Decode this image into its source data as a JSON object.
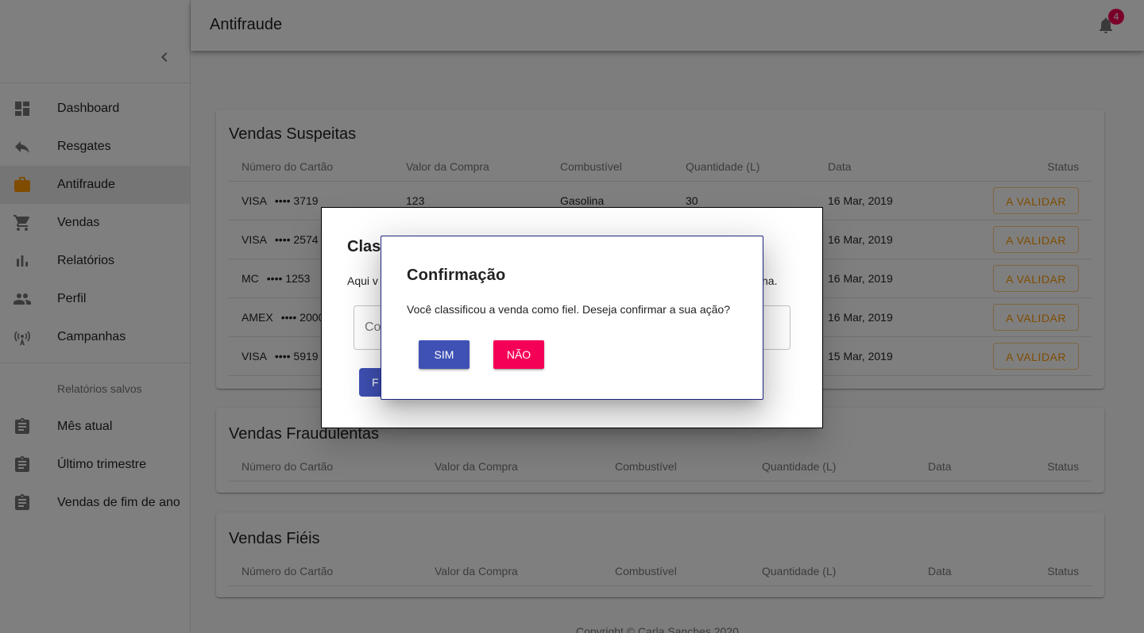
{
  "appbar": {
    "title": "Antifraude",
    "notification_count": "4"
  },
  "sidebar": {
    "items": [
      {
        "label": "Dashboard",
        "icon": "dashboard-icon"
      },
      {
        "label": "Resgates",
        "icon": "reply-icon"
      },
      {
        "label": "Antifraude",
        "icon": "briefcase-icon",
        "active": true
      },
      {
        "label": "Vendas",
        "icon": "cart-icon"
      },
      {
        "label": "Relatórios",
        "icon": "bar-chart-icon"
      },
      {
        "label": "Perfil",
        "icon": "people-icon"
      },
      {
        "label": "Campanhas",
        "icon": "broadcast-icon"
      }
    ],
    "saved_header": "Relatórios salvos",
    "saved": [
      {
        "label": "Mês atual",
        "icon": "clipboard-icon"
      },
      {
        "label": "Último trimestre",
        "icon": "clipboard-icon"
      },
      {
        "label": "Vendas de fim de ano",
        "icon": "clipboard-icon"
      }
    ]
  },
  "suspeitas": {
    "title": "Vendas Suspeitas",
    "headers": [
      "Número do Cartão",
      "Valor da Compra",
      "Combustível",
      "Quantidade (L)",
      "Data",
      "Status"
    ],
    "rows": [
      {
        "brand": "VISA",
        "digits": "•••• 3719",
        "valor": "123",
        "combustivel": "Gasolina",
        "quantidade": "30",
        "data": "16 Mar, 2019",
        "status": "A VALIDAR"
      },
      {
        "brand": "VISA",
        "digits": "•••• 2574",
        "valor": "",
        "combustivel": "",
        "quantidade": "",
        "data": "16 Mar, 2019",
        "status": "A VALIDAR"
      },
      {
        "brand": "MC",
        "digits": "•••• 1253",
        "valor": "",
        "combustivel": "",
        "quantidade": "",
        "data": "16 Mar, 2019",
        "status": "A VALIDAR"
      },
      {
        "brand": "AMEX",
        "digits": "•••• 2000",
        "valor": "",
        "combustivel": "",
        "quantidade": "",
        "data": "16 Mar, 2019",
        "status": "A VALIDAR"
      },
      {
        "brand": "VISA",
        "digits": "•••• 5919",
        "valor": "",
        "combustivel": "",
        "quantidade": "",
        "data": "15 Mar, 2019",
        "status": "A VALIDAR"
      }
    ]
  },
  "fraudulentas": {
    "title": "Vendas Fraudulentas",
    "headers": [
      "Número do Cartão",
      "Valor da Compra",
      "Combustível",
      "Quantidade (L)",
      "Data",
      "Status"
    ]
  },
  "fieis": {
    "title": "Vendas Fiéis",
    "headers": [
      "Número do Cartão",
      "Valor da Compra",
      "Combustível",
      "Quantidade (L)",
      "Data",
      "Status"
    ]
  },
  "footer": {
    "text": "Copyright © Carla Sanches 2020"
  },
  "dialog_classify": {
    "title": "Clas",
    "text": "Aqui v",
    "text_end": "na.",
    "input_placeholder": "Co",
    "button": "F"
  },
  "dialog_confirm": {
    "title": "Confirmação",
    "message": "Você classificou a venda como fiel. Deseja confirmar a sua ação?",
    "yes": "SIM",
    "no": "NÃO"
  }
}
